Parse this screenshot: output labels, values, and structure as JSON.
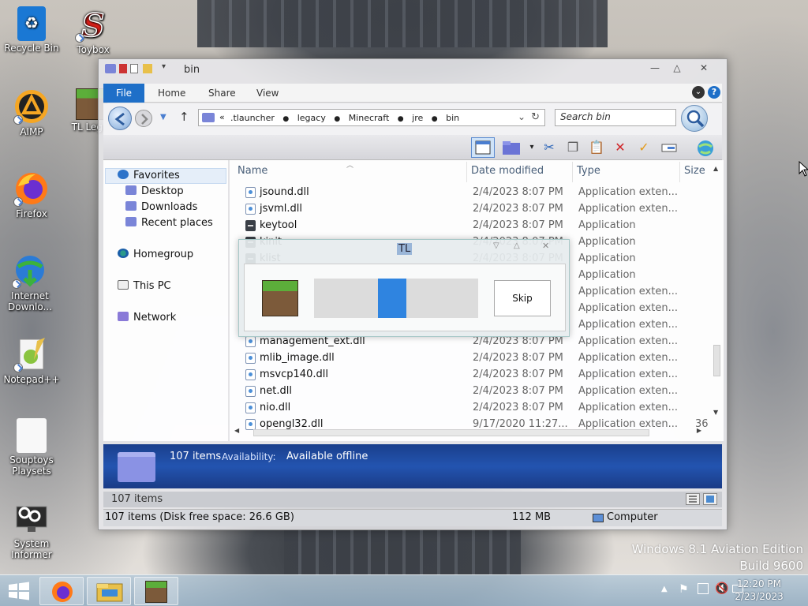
{
  "desktop": {
    "icons": [
      {
        "label": "Recycle Bin"
      },
      {
        "label": "Toybox"
      },
      {
        "label": "AIMP"
      },
      {
        "label": "TL Leg..."
      },
      {
        "label": "Firefox"
      },
      {
        "label": "Internet Downlo..."
      },
      {
        "label": "Notepad++"
      },
      {
        "label": "Souptoys Playsets"
      },
      {
        "label": "System Informer"
      }
    ],
    "watermark_line1": "Windows 8.1 Aviation Edition",
    "watermark_line2": "Build 9600"
  },
  "explorer": {
    "title": "bin",
    "window_buttons": {
      "minimize": "—",
      "maximize": "△",
      "close": "✕"
    },
    "ribbon_tabs": [
      "File",
      "Home",
      "Share",
      "View"
    ],
    "help_label": "?",
    "address": {
      "chevron": "«",
      "segments": [
        ".tlauncher",
        "legacy",
        "Minecraft",
        "jre",
        "bin"
      ],
      "refresh": "↻"
    },
    "search_placeholder": "Search bin",
    "nav_pane": {
      "favorites": "Favorites",
      "desktop": "Desktop",
      "downloads": "Downloads",
      "recent": "Recent places",
      "homegroup": "Homegroup",
      "this_pc": "This PC",
      "network": "Network"
    },
    "columns": {
      "name": "Name",
      "date": "Date modified",
      "type": "Type",
      "size": "Size"
    },
    "files": [
      {
        "name": "jsound.dll",
        "date": "2/4/2023 8:07 PM",
        "type": "Application exten...",
        "size": ""
      },
      {
        "name": "jsvml.dll",
        "date": "2/4/2023 8:07 PM",
        "type": "Application exten...",
        "size": ""
      },
      {
        "name": "keytool",
        "date": "2/4/2023 8:07 PM",
        "type": "Application",
        "size": ""
      },
      {
        "name": "kinit",
        "date": "2/4/2023 8:07 PM",
        "type": "Application",
        "size": ""
      },
      {
        "name": "klist",
        "date": "2/4/2023 8:07 PM",
        "type": "Application",
        "size": ""
      },
      {
        "name": "",
        "date": "",
        "type": "Application",
        "size": ""
      },
      {
        "name": "",
        "date": "",
        "type": "Application exten...",
        "size": ""
      },
      {
        "name": "",
        "date": "",
        "type": "Application exten...",
        "size": ""
      },
      {
        "name": "",
        "date": "",
        "type": "Application exten...",
        "size": ""
      },
      {
        "name": "management_ext.dll",
        "date": "2/4/2023 8:07 PM",
        "type": "Application exten...",
        "size": ""
      },
      {
        "name": "mlib_image.dll",
        "date": "2/4/2023 8:07 PM",
        "type": "Application exten...",
        "size": ""
      },
      {
        "name": "msvcp140.dll",
        "date": "2/4/2023 8:07 PM",
        "type": "Application exten...",
        "size": ""
      },
      {
        "name": "net.dll",
        "date": "2/4/2023 8:07 PM",
        "type": "Application exten...",
        "size": ""
      },
      {
        "name": "nio.dll",
        "date": "2/4/2023 8:07 PM",
        "type": "Application exten...",
        "size": ""
      },
      {
        "name": "opengl32.dll",
        "date": "9/17/2020 11:27...",
        "type": "Application exten...",
        "size": "36"
      }
    ],
    "details": {
      "count": "107 items",
      "availability_label": "Availability:",
      "availability_value": "Available offline"
    },
    "status1": "107 items",
    "status2": {
      "left": "107 items (Disk free space: 26.6 GB)",
      "size": "112 MB",
      "location": "Computer"
    }
  },
  "tl_dialog": {
    "title": "TL",
    "skip_label": "Skip",
    "progress_fraction": 0.47
  },
  "taskbar": {
    "time": "12:20 PM",
    "date": "2/23/2023"
  },
  "colors": {
    "accent": "#1e6fc8",
    "progress": "#2f84e0",
    "details_pane": "#2354b0"
  }
}
